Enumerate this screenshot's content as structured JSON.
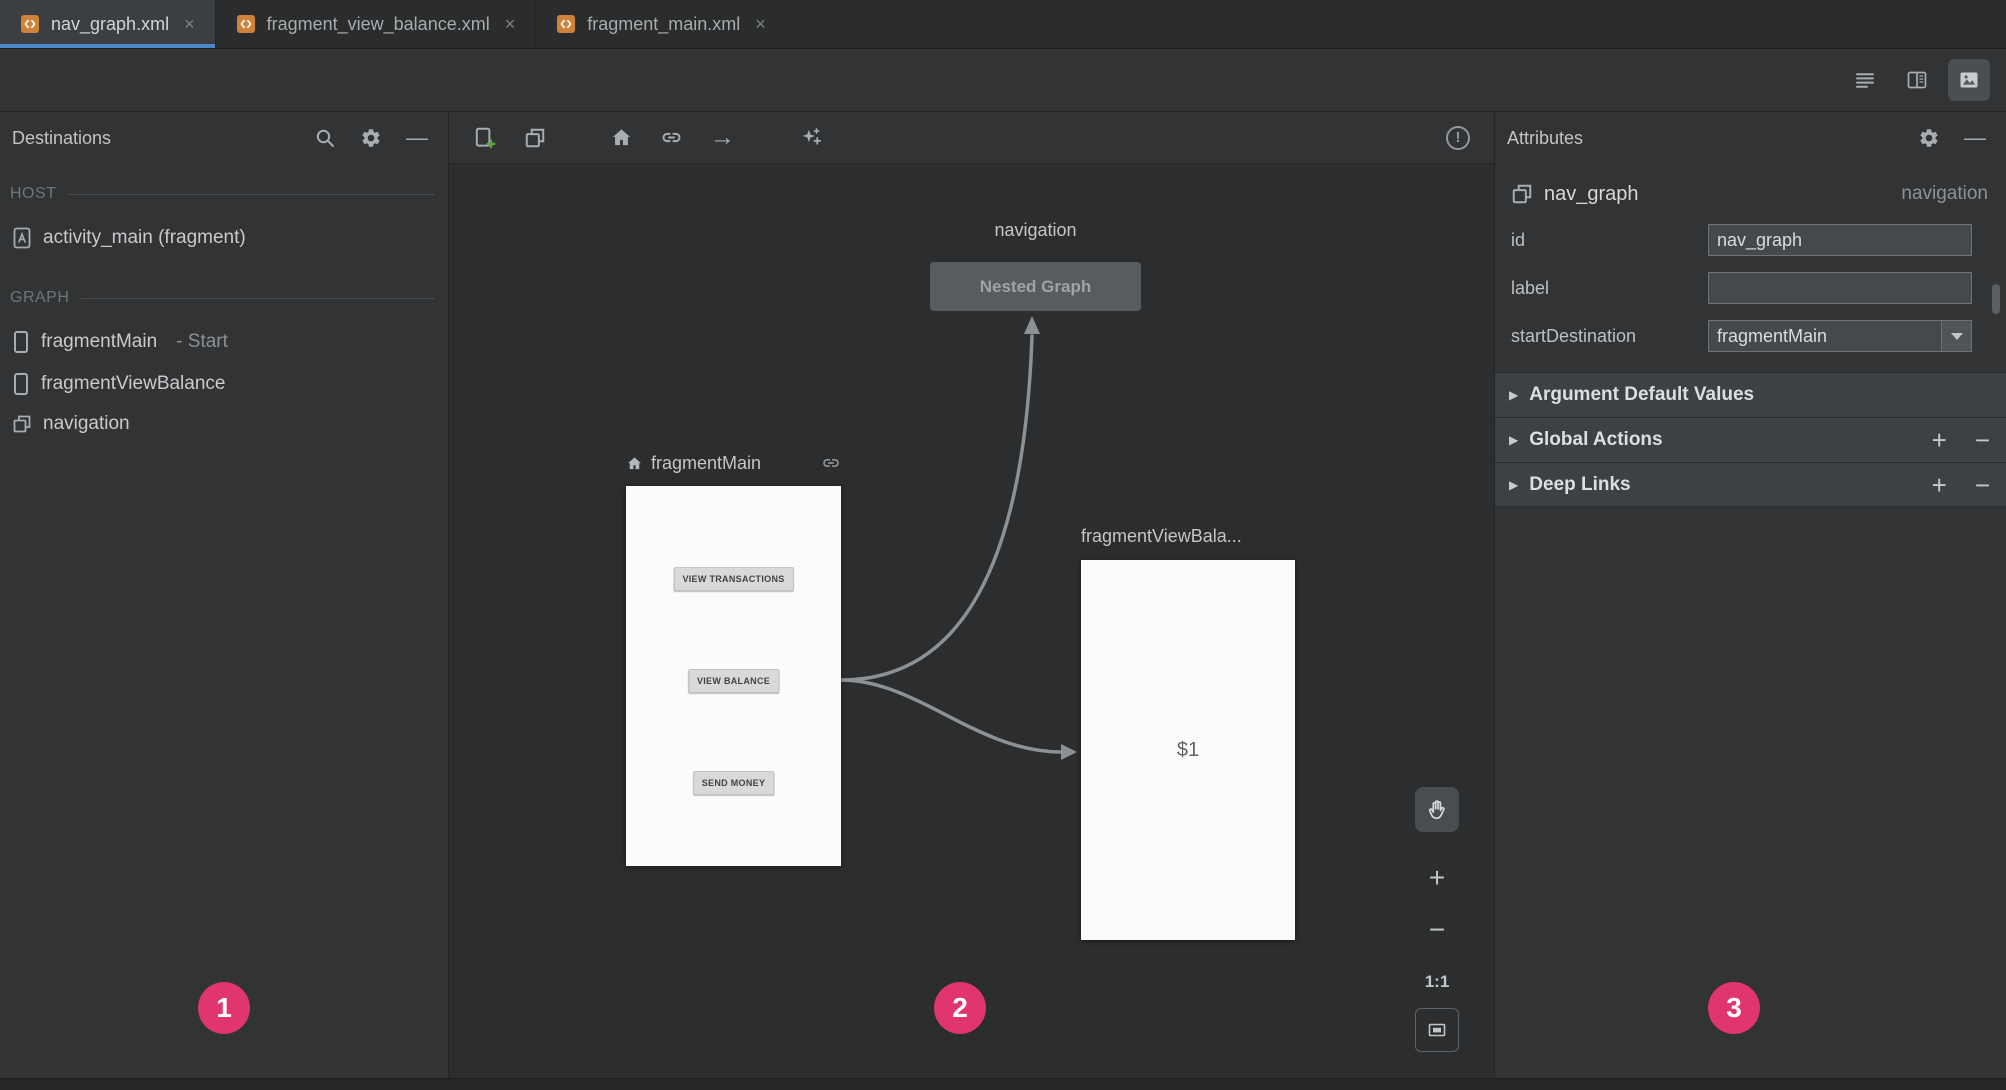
{
  "colors": {
    "tab_underline": "#4a88c7",
    "badge": "#e0356d",
    "panel_bg": "#313335",
    "canvas_bg": "#2b2d2e",
    "frame_bg": "#fbfbfb",
    "add_green": "#57a64a",
    "arrow_gray": "#8e9193"
  },
  "glyphs": {
    "close": "×",
    "hide": "—",
    "plus": "+",
    "minus": "−",
    "collapse": "▶",
    "arrow_right": "→",
    "warning": "!",
    "zoom_in": "+",
    "zoom_out": "−",
    "zoom_reset": "1:1"
  },
  "tabs": [
    {
      "label": "nav_graph.xml",
      "active": true
    },
    {
      "label": "fragment_view_balance.xml",
      "active": false
    },
    {
      "label": "fragment_main.xml",
      "active": false
    }
  ],
  "destinations": {
    "title": "Destinations",
    "host_header": "HOST",
    "host_items": [
      {
        "label": "activity_main (fragment)"
      }
    ],
    "graph_header": "GRAPH",
    "graph_items": [
      {
        "label": "fragmentMain",
        "suffix": "- Start"
      },
      {
        "label": "fragmentViewBalance",
        "suffix": ""
      },
      {
        "label": "navigation",
        "suffix": ""
      }
    ]
  },
  "canvas": {
    "nested_graph": {
      "title": "navigation",
      "label": "Nested Graph"
    },
    "fragment_main": {
      "title": "fragmentMain",
      "preview_buttons": [
        "VIEW TRANSACTIONS",
        "VIEW BALANCE",
        "SEND MONEY"
      ]
    },
    "fragment_view_balance": {
      "title": "fragmentViewBala...",
      "content": "$1"
    }
  },
  "attributes": {
    "title": "Attributes",
    "component_name": "nav_graph",
    "component_type": "navigation",
    "fields": {
      "id": {
        "label": "id",
        "value": "nav_graph"
      },
      "label": {
        "label": "label",
        "value": ""
      },
      "start_destination": {
        "label": "startDestination",
        "value": "fragmentMain"
      }
    },
    "sections": [
      {
        "label": "Argument Default Values"
      },
      {
        "label": "Global Actions"
      },
      {
        "label": "Deep Links"
      }
    ]
  },
  "annotations": [
    {
      "number": "1"
    },
    {
      "number": "2"
    },
    {
      "number": "3"
    }
  ]
}
